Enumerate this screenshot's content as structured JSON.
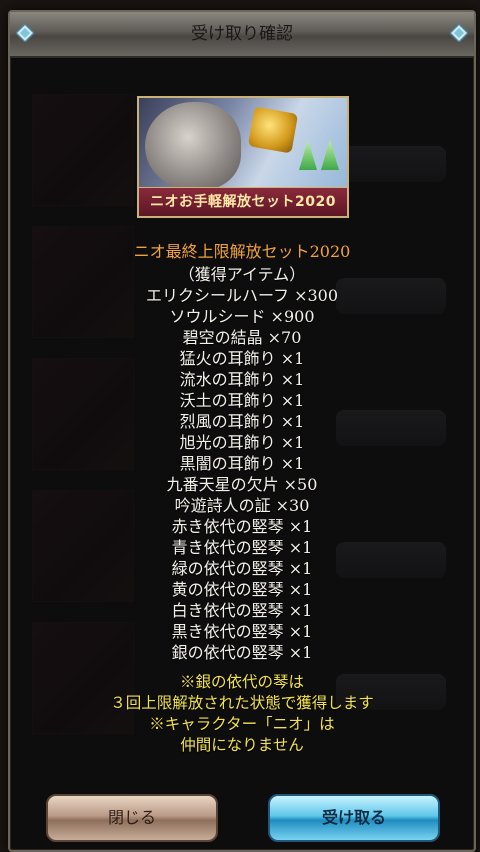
{
  "dialog": {
    "title": "受け取り確認",
    "banner_label": "ニオお手軽解放セット2020",
    "set_name": "ニオ最終上限解放セット2020",
    "items": [
      "（獲得アイテム）",
      "エリクシールハーフ ×300",
      "ソウルシード ×900",
      "碧空の結晶 ×70",
      "猛火の耳飾り ×1",
      "流水の耳飾り ×1",
      "沃土の耳飾り ×1",
      "烈風の耳飾り ×1",
      "旭光の耳飾り ×1",
      "黒闇の耳飾り ×1",
      "九番天星の欠片 ×50",
      "吟遊詩人の証 ×30",
      "赤き依代の竪琴 ×1",
      "青き依代の竪琴 ×1",
      "緑の依代の竪琴 ×1",
      "黄の依代の竪琴 ×1",
      "白き依代の竪琴 ×1",
      "黒き依代の竪琴 ×1",
      "銀の依代の竪琴 ×1"
    ],
    "notes": [
      "※銀の依代の琴は",
      "３回上限解放された状態で獲得します",
      "※キャラクター「ニオ」は",
      "仲間になりません"
    ],
    "buttons": {
      "close": "閉じる",
      "receive": "受け取る"
    }
  },
  "colors": {
    "set_name": "#f0a23a",
    "note": "#f2e24a",
    "item_text": "#f4f1ea"
  },
  "icons": {
    "corner": "diamond-icon"
  }
}
